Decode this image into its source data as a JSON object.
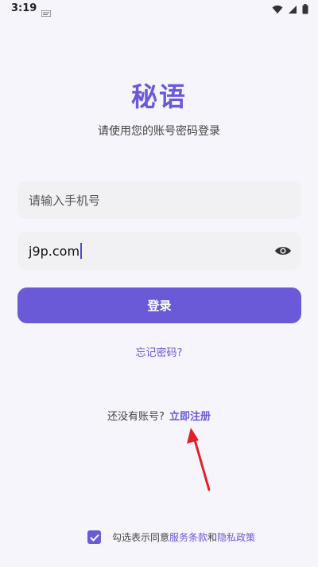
{
  "status_bar": {
    "time": "3:19"
  },
  "app": {
    "title": "秘语",
    "subtitle": "请使用您的账号密码登录"
  },
  "form": {
    "phone_placeholder": "请输入手机号",
    "password_value": "j9p.com",
    "login_label": "登录",
    "forgot_label": "忘记密码?"
  },
  "register": {
    "prompt": "还没有账号?",
    "link_label": "立即注册"
  },
  "agreement": {
    "checked": true,
    "prefix": "勾选表示同意",
    "terms_label": "服务条款",
    "and": "和",
    "privacy_label": "隐私政策"
  },
  "colors": {
    "accent": "#6a5ad8",
    "background": "#f6f5fb",
    "field_bg": "#f1f0f2",
    "arrow": "#e0202a"
  },
  "icons": {
    "notification": "notification-icon",
    "wifi": "wifi-icon",
    "signal": "signal-icon",
    "battery": "battery-icon",
    "password_visibility": "eye-icon",
    "checkbox": "check-icon"
  }
}
